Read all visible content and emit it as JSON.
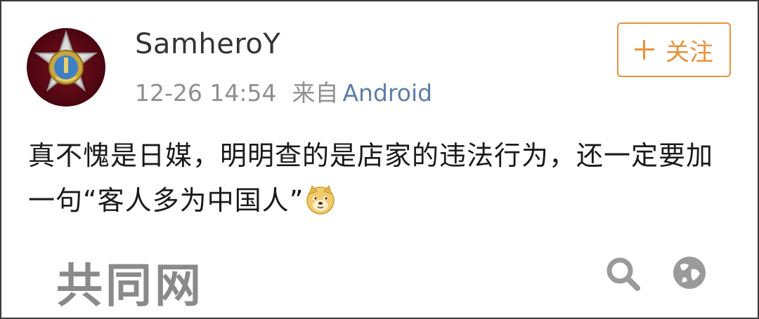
{
  "post": {
    "username": "SamheroY",
    "timestamp": "12-26 14:54",
    "from_label": "来自",
    "source": "Android",
    "follow_label": "关注",
    "text": "真不愧是日媒，明明查的是店家的违法行为，还一定要加一句“客人多为中国人”",
    "emoji": "doge-icon"
  },
  "embedded_image": {
    "watermark": "共同网",
    "icons": [
      "search-icon",
      "globe-icon"
    ]
  },
  "colors": {
    "accent": "#e8923a",
    "link": "#5b7fa8",
    "meta": "#8f8f8f",
    "text": "#1a1a1a"
  }
}
